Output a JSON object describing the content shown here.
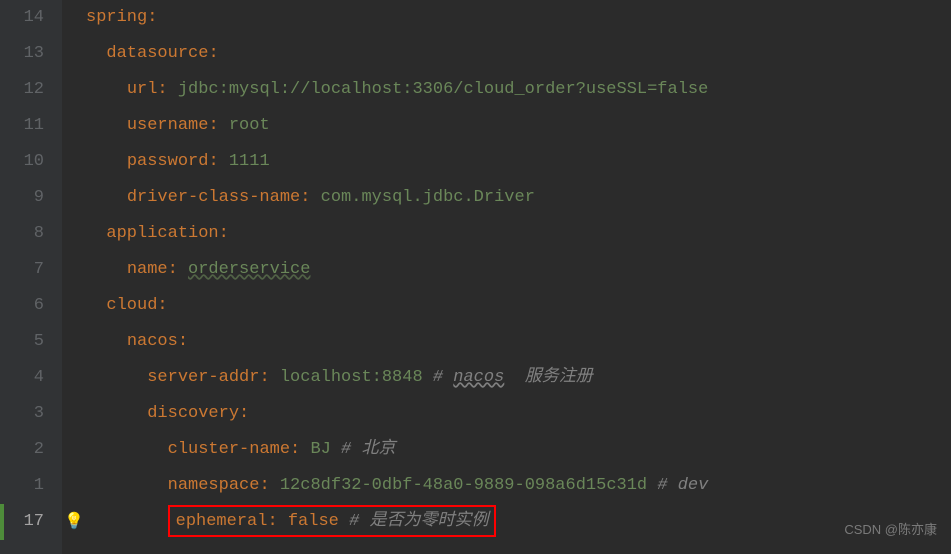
{
  "gutter": [
    "14",
    "13",
    "12",
    "11",
    "10",
    "9",
    "8",
    "7",
    "6",
    "5",
    "4",
    "3",
    "2",
    "1",
    "17"
  ],
  "code": {
    "l1": {
      "key": "spring",
      "colon": ":"
    },
    "l2": {
      "indent": "  ",
      "key": "datasource",
      "colon": ":"
    },
    "l3": {
      "indent": "    ",
      "key": "url",
      "colon": ": ",
      "value": "jdbc:mysql://localhost:3306/cloud_order?useSSL=false"
    },
    "l4": {
      "indent": "    ",
      "key": "username",
      "colon": ": ",
      "value": "root"
    },
    "l5": {
      "indent": "    ",
      "key": "password",
      "colon": ": ",
      "value": "1111"
    },
    "l6": {
      "indent": "    ",
      "key": "driver-class-name",
      "colon": ": ",
      "value": "com.mysql.jdbc.Driver"
    },
    "l7": {
      "indent": "  ",
      "key": "application",
      "colon": ":"
    },
    "l8": {
      "indent": "    ",
      "key": "name",
      "colon": ": ",
      "value": "orderservice"
    },
    "l9": {
      "indent": "  ",
      "key": "cloud",
      "colon": ":"
    },
    "l10": {
      "indent": "    ",
      "key": "nacos",
      "colon": ":"
    },
    "l11": {
      "indent": "      ",
      "key": "server-addr",
      "colon": ": ",
      "value": "localhost:8848",
      "hash": " # ",
      "comment_link": "nacos",
      "comment": "  服务注册"
    },
    "l12": {
      "indent": "      ",
      "key": "discovery",
      "colon": ":"
    },
    "l13": {
      "indent": "        ",
      "key": "cluster-name",
      "colon": ": ",
      "value": "BJ",
      "hash": " # ",
      "comment": "北京"
    },
    "l14": {
      "indent": "        ",
      "key": "namespace",
      "colon": ": ",
      "value": "12c8df32-0dbf-48a0-9889-098a6d15c31d",
      "hash": " # ",
      "comment": "dev"
    },
    "l15": {
      "indent": "        ",
      "key": "ephemeral",
      "colon": ": ",
      "value": "false",
      "hash": " # ",
      "comment": "是否为零时实例"
    }
  },
  "bulb": "💡",
  "watermark": "CSDN @陈亦康",
  "chart_data": {
    "type": "table",
    "title": "Spring application.yml configuration",
    "content": {
      "spring": {
        "datasource": {
          "url": "jdbc:mysql://localhost:3306/cloud_order?useSSL=false",
          "username": "root",
          "password": "1111",
          "driver-class-name": "com.mysql.jdbc.Driver"
        },
        "application": {
          "name": "orderservice"
        },
        "cloud": {
          "nacos": {
            "server-addr": "localhost:8848",
            "_comment_server-addr": "nacos 服务注册",
            "discovery": {
              "cluster-name": "BJ",
              "_comment_cluster-name": "北京",
              "namespace": "12c8df32-0dbf-48a0-9889-098a6d15c31d",
              "_comment_namespace": "dev",
              "ephemeral": false,
              "_comment_ephemeral": "是否为零时实例"
            }
          }
        }
      }
    }
  }
}
